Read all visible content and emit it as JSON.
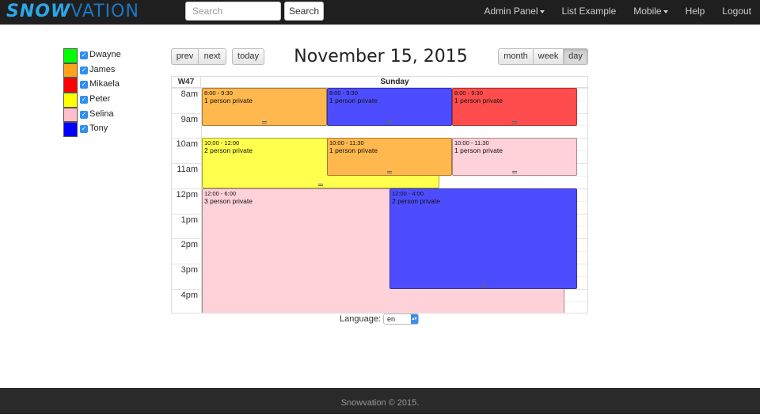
{
  "nav": {
    "logo_bold": "SNOW",
    "logo_light": "VATION",
    "search_placeholder": "Search",
    "search_button": "Search",
    "links": [
      {
        "label": "Admin Panel",
        "dropdown": true
      },
      {
        "label": "List Example",
        "dropdown": false
      },
      {
        "label": "Mobile",
        "dropdown": true
      },
      {
        "label": "Help",
        "dropdown": false
      },
      {
        "label": "Logout",
        "dropdown": false
      }
    ]
  },
  "legend": [
    {
      "name": "Dwayne",
      "color": "#00ff00",
      "checked": true
    },
    {
      "name": "James",
      "color": "#ffa31a",
      "checked": true
    },
    {
      "name": "Mikaela",
      "color": "#ff0000",
      "checked": true
    },
    {
      "name": "Peter",
      "color": "#ffff00",
      "checked": true
    },
    {
      "name": "Selina",
      "color": "#ffc0cb",
      "checked": true
    },
    {
      "name": "Tony",
      "color": "#0000ff",
      "checked": true
    }
  ],
  "toolbar": {
    "prev": "prev",
    "next": "next",
    "today": "today",
    "month": "month",
    "week": "week",
    "day": "day",
    "active_view": "day"
  },
  "calendar": {
    "title": "November 15, 2015",
    "week_label": "W47",
    "day_label": "Sunday",
    "hours": [
      "8am",
      "9am",
      "10am",
      "11am",
      "12pm",
      "1pm",
      "2pm",
      "3pm",
      "4pm"
    ],
    "events": [
      {
        "time": "8:00 - 9:30",
        "title": "1 person private",
        "color": "#ffb84d",
        "start": 8.0,
        "end": 9.5,
        "col": 0,
        "span": 1,
        "cols": 3
      },
      {
        "time": "8:00 - 9:30",
        "title": "1 person private",
        "color": "#4d4dff",
        "start": 8.0,
        "end": 9.5,
        "col": 1,
        "span": 1,
        "cols": 3
      },
      {
        "time": "8:00 - 9:30",
        "title": "1 person private",
        "color": "#ff4d4d",
        "start": 8.0,
        "end": 9.5,
        "col": 2,
        "span": 1,
        "cols": 3
      },
      {
        "time": "10:00 - 12:00",
        "title": "2 person private",
        "color": "#ffff4d",
        "start": 10.0,
        "end": 12.0,
        "col": 0,
        "span": 1.9,
        "cols": 3
      },
      {
        "time": "10:00 - 11:30",
        "title": "1 person private",
        "color": "#ffb84d",
        "start": 10.0,
        "end": 11.5,
        "col": 1,
        "span": 1,
        "cols": 3
      },
      {
        "time": "10:00 - 11:30",
        "title": "1 person private",
        "color": "#ffd1d9",
        "start": 10.0,
        "end": 11.5,
        "col": 2,
        "span": 1,
        "cols": 3
      },
      {
        "time": "12:00 - 6:00",
        "title": "3 person private",
        "color": "#ffd1d9",
        "start": 12.0,
        "end": 18.0,
        "col": 0,
        "span": 2.9,
        "cols": 3
      },
      {
        "time": "12:00 - 4:00",
        "title": "2 person private",
        "color": "#4d4dff",
        "start": 12.0,
        "end": 16.0,
        "col": 1.5,
        "span": 1.5,
        "cols": 3
      }
    ]
  },
  "language": {
    "label": "Language:",
    "value": "en"
  },
  "footer": {
    "text": "Snowvation © 2015."
  }
}
